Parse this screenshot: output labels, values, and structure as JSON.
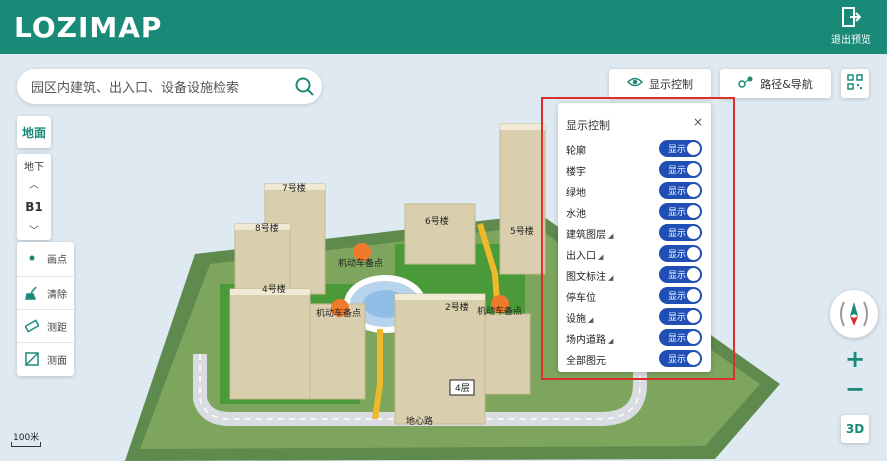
{
  "app": {
    "logo_text": "LOZIMAP",
    "exit_label": "退出预览"
  },
  "search": {
    "placeholder": "园区内建筑、出入口、设备设施检索"
  },
  "toolbar": {
    "display_control_label": "显示控制",
    "route_nav_label": "路径&导航",
    "qr_icon": "qr-code-icon"
  },
  "left_controls": {
    "ground_label": "地面",
    "floor_label": "地下",
    "current_floor": "B1",
    "tools": [
      {
        "label": "画点",
        "icon": "dot-icon"
      },
      {
        "label": "清除",
        "icon": "broom-icon"
      },
      {
        "label": "测距",
        "icon": "ruler-icon"
      },
      {
        "label": "测面",
        "icon": "area-icon"
      }
    ]
  },
  "panel": {
    "title": "显示控制",
    "close": "×",
    "toggle_text": "显示",
    "rows": [
      {
        "label": "轮廓",
        "expandable": false
      },
      {
        "label": "楼宇",
        "expandable": false
      },
      {
        "label": "绿地",
        "expandable": false
      },
      {
        "label": "水池",
        "expandable": false
      },
      {
        "label": "建筑图层",
        "expandable": true
      },
      {
        "label": "出入口",
        "expandable": true
      },
      {
        "label": "图文标注",
        "expandable": true
      },
      {
        "label": "停车位",
        "expandable": false
      },
      {
        "label": "设施",
        "expandable": true
      },
      {
        "label": "场内道路",
        "expandable": true
      },
      {
        "label": "全部图元",
        "expandable": false
      }
    ]
  },
  "map": {
    "buildings": [
      "7号楼",
      "8号楼",
      "6号楼",
      "5号楼",
      "4号楼",
      "2号楼"
    ],
    "markers": [
      "机动车备点",
      "机动车备点",
      "机动车备点"
    ],
    "floor_tag": "4层",
    "road_label": "地心路",
    "scale_label": "100米"
  },
  "right_controls": {
    "zoom_in": "+",
    "zoom_out": "−",
    "view_3d": "3D"
  },
  "colors": {
    "brand": "#1a8a78",
    "toggle_on": "#1f4fb5",
    "highlight": "#d9302b",
    "marker": "#f07a2c"
  }
}
